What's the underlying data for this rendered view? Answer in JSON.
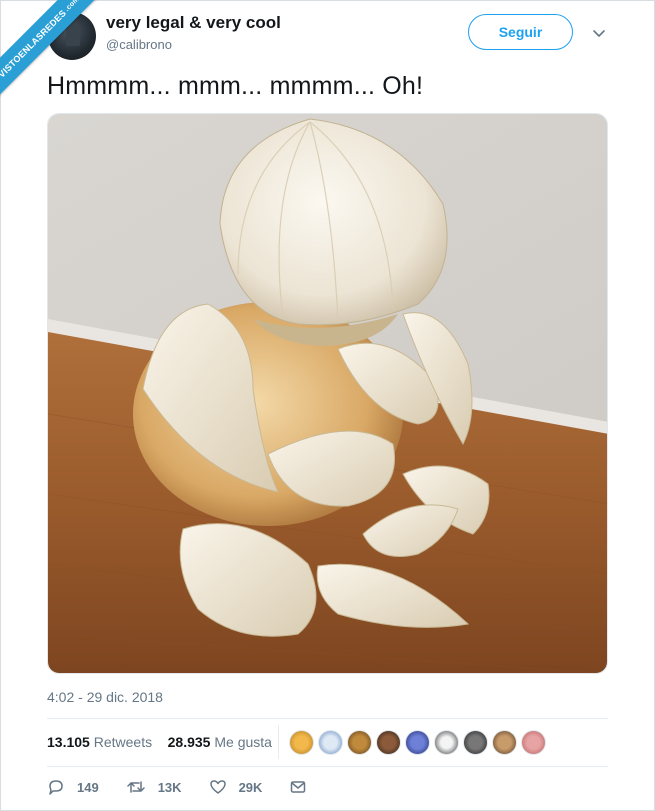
{
  "watermark": {
    "text": "VISTOENLASREDES",
    "suffix": ".com"
  },
  "user": {
    "name": "very legal & very cool",
    "handle": "@calibrono"
  },
  "follow_label": "Seguir",
  "tweet_text": "Hmmmm... mmm... mmmm... Oh!",
  "timestamp": "4:02 - 29 dic. 2018",
  "stats": {
    "retweets_count": "13.105",
    "retweets_label": "Retweets",
    "likes_count": "28.935",
    "likes_label": "Me gusta"
  },
  "actions": {
    "replies": "149",
    "retweets": "13K",
    "likes": "29K"
  },
  "colors": {
    "accent": "#1da1f2",
    "muted": "#657786",
    "ribbon": "#2a9fd6"
  }
}
